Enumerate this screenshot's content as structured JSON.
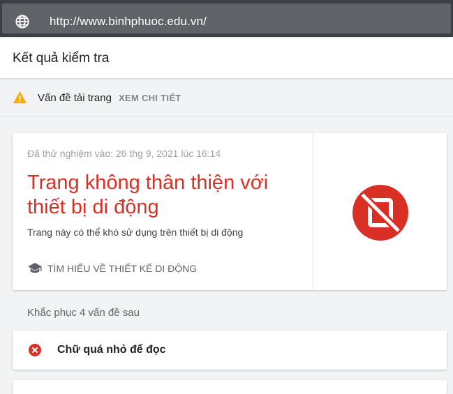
{
  "url_bar": {
    "url": "http://www.binhphuoc.edu.vn/",
    "icon": "globe-icon"
  },
  "header": {
    "title": "Kết quả kiểm tra"
  },
  "warning": {
    "icon": "warning-icon",
    "text": "Vấn đề tải trang",
    "link_label": "XEM CHI TIẾT"
  },
  "result": {
    "tested_at": "Đã thử nghiệm vào: 26 thg 9, 2021 lúc 16:14",
    "verdict": "Trang không thân thiện với thiết bị di động",
    "description": "Trang này có thể khó sử dụng trên thiết bị di động",
    "learn_link_icon": "graduation-cap-icon",
    "learn_link_label": "TÌM HIỂU VỀ THIẾT KẾ DI ĐỘNG",
    "status_icon": "not-mobile-friendly-icon"
  },
  "issues": {
    "heading": "Khắc phục 4 vấn đề sau",
    "items": [
      {
        "icon": "error-icon",
        "label": "Chữ quá nhỏ để đọc"
      }
    ]
  },
  "colors": {
    "error": "#d93025",
    "warning": "#f9ab00",
    "urlbar_bg": "#3c4043",
    "muted_text": "#5f6368"
  }
}
